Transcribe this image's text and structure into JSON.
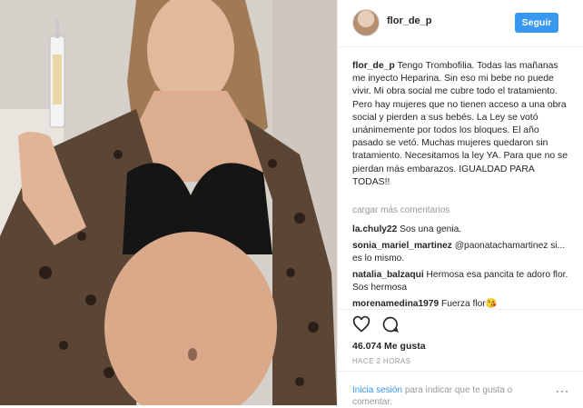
{
  "post": {
    "username": "flor_de_p",
    "follow_label": "Seguir",
    "caption_text": "Tengo Trombofilia. Todas las mañanas me inyecto Heparina. Sin eso mi bebe no puede vivir. Mi obra social me cubre todo el tratamiento. Pero hay mujeres que no tienen acceso a una obra social y pierden a sus bebés. La Ley se votó unánimemente por todos los bloques. El año pasado se vetó. Muchas mujeres quedaron sin tratamiento. Necesitamos la ley YA. Para que no se pierdan más embarazos. IGUALDAD PARA TODAS!!",
    "load_more": "cargar más comentarios",
    "likes": "46.074 Me gusta",
    "time_ago": "HACE 2 HORAS"
  },
  "comments": [
    {
      "user": "la.chuly22",
      "text": "Sos una genia."
    },
    {
      "user": "sonia_mariel_martinez",
      "text": "@paonatachamartinez si... es lo mismo."
    },
    {
      "user": "natalia_balzaqui",
      "text": "Hermosa esa pancita te adoro flor. Sos hermosa"
    },
    {
      "user": "morenamedina1979",
      "text": "Fuerza flor😘"
    }
  ],
  "footer": {
    "login_link": "Inicia sesión",
    "login_rest": "para indicar que te gusta o comentar.",
    "options": "···"
  },
  "icons": {
    "like": "heart-outline-icon",
    "comment": "comment-bubble-icon"
  },
  "colors": {
    "accent": "#3897f0",
    "muted": "#999999"
  }
}
